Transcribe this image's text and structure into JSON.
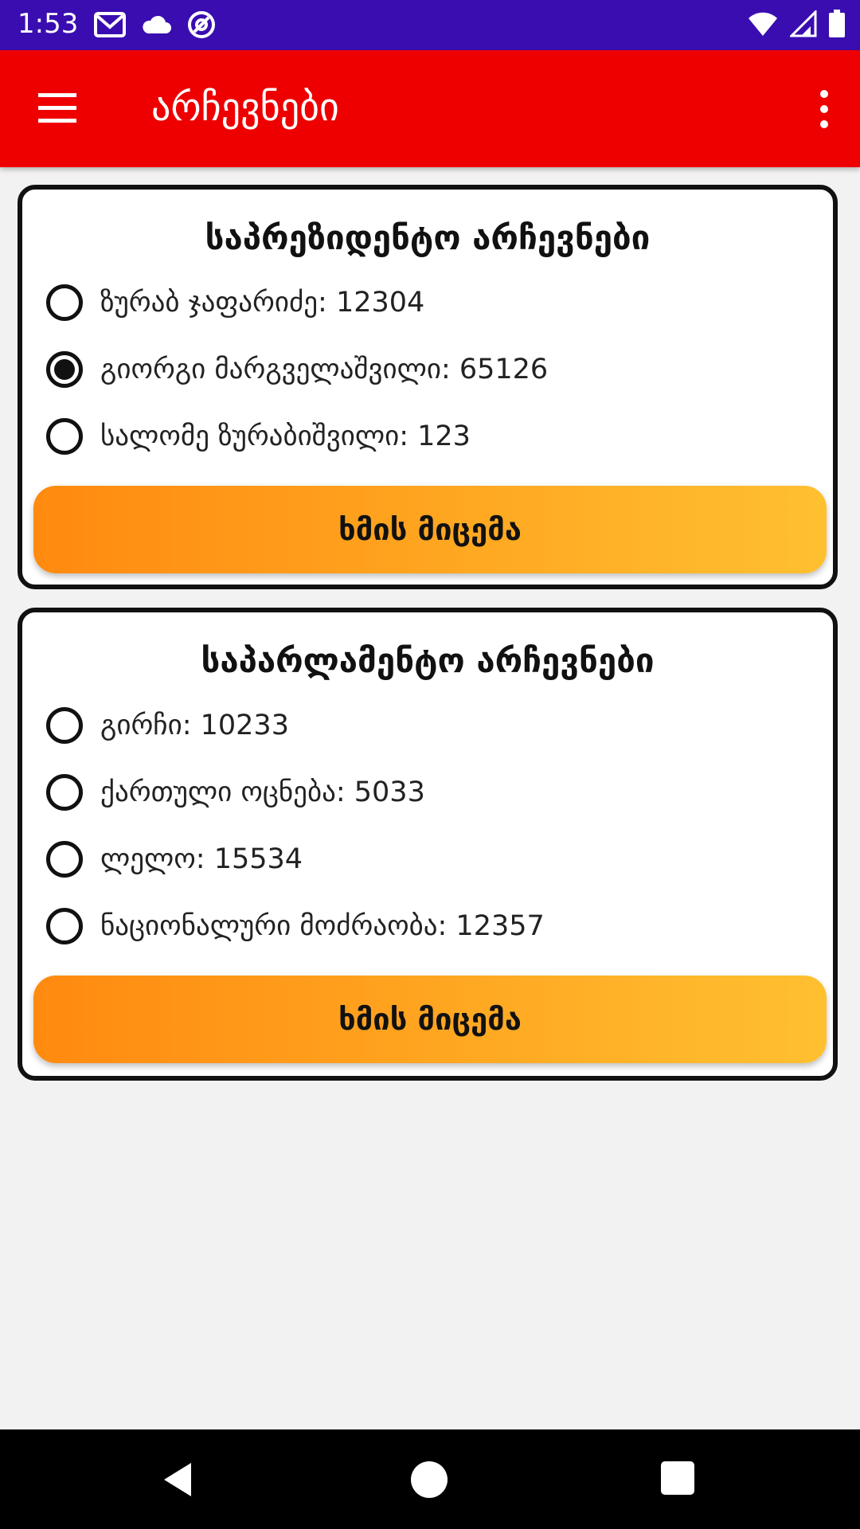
{
  "status_bar": {
    "time": "1:53",
    "icons_left": [
      "gmail-icon",
      "cloud-icon",
      "vpn-icon"
    ],
    "icons_right": [
      "wifi-icon",
      "signal-icon",
      "battery-icon"
    ]
  },
  "app_bar": {
    "title": "არჩევნები",
    "menu_icon": "hamburger-menu-icon",
    "overflow_icon": "more-vert-icon",
    "color": "#ee0000"
  },
  "presidential": {
    "title": "საპრეზიდენტო არჩევნები",
    "options": [
      {
        "label": "ზურაბ ჯაფარიძე: 12304",
        "selected": false
      },
      {
        "label": "გიორგი მარგველაშვილი: 65126",
        "selected": true
      },
      {
        "label": "სალომე ზურაბიშვილი: 123",
        "selected": false
      }
    ],
    "vote_label": "ხმის მიცემა"
  },
  "parliamentary": {
    "title": "საპარლამენტო არჩევნები",
    "options": [
      {
        "label": "გირჩი: 10233",
        "selected": false
      },
      {
        "label": "ქართული ოცნება: 5033",
        "selected": false
      },
      {
        "label": "ლელო: 15534",
        "selected": false
      },
      {
        "label": "ნაციონალური მოძრაობა: 12357",
        "selected": false
      }
    ],
    "vote_label": "ხმის მიცემა"
  },
  "colors": {
    "status_bar": "#3a0db0",
    "button_gradient_start": "#ff8a10",
    "button_gradient_end": "#ffc030"
  }
}
